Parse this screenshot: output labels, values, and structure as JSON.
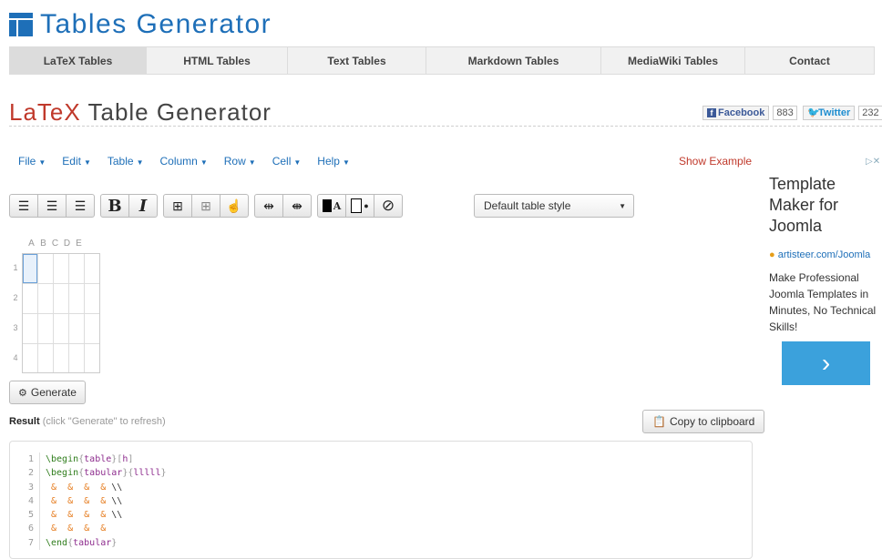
{
  "logo": {
    "text": "Tables Generator"
  },
  "nav": [
    {
      "label": "LaTeX Tables"
    },
    {
      "label": "HTML Tables"
    },
    {
      "label": "Text Tables"
    },
    {
      "label": "Markdown Tables"
    },
    {
      "label": "MediaWiki Tables"
    },
    {
      "label": "Contact"
    }
  ],
  "title": {
    "accent": "LaTeX",
    "rest": " Table Generator"
  },
  "social": {
    "facebook": {
      "label": "Facebook",
      "count": "883"
    },
    "twitter": {
      "label": "Twitter",
      "count": "232"
    }
  },
  "menu": [
    {
      "label": "File"
    },
    {
      "label": "Edit"
    },
    {
      "label": "Table"
    },
    {
      "label": "Column"
    },
    {
      "label": "Row"
    },
    {
      "label": "Cell"
    },
    {
      "label": "Help"
    }
  ],
  "show_example": "Show Example",
  "toolbar": {
    "bold": "B",
    "italic": "I",
    "text_color_glyph": "A",
    "style_select": "Default table style"
  },
  "grid": {
    "columns": [
      "A",
      "B",
      "C",
      "D",
      "E"
    ],
    "rows": [
      "1",
      "2",
      "3",
      "4"
    ]
  },
  "generate_label": "Generate",
  "result": {
    "label": "Result",
    "hint": "(click \"Generate\" to refresh)"
  },
  "copy_label": "Copy to clipboard",
  "code": {
    "line_numbers": [
      "1",
      "2",
      "3",
      "4",
      "5",
      "6",
      "7"
    ],
    "l1": {
      "cmd": "\\begin",
      "arg1": "table",
      "arg2": "h"
    },
    "l2": {
      "cmd": "\\begin",
      "arg1": "tabular",
      "arg2": "lllll"
    },
    "amp_row": " &  &  &  & ",
    "newline": "\\\\",
    "l7": {
      "cmd": "\\end",
      "arg1": "tabular"
    }
  },
  "ad": {
    "close": "▷✕",
    "title": "Template Maker for Joomla",
    "url": "artisteer.com/Joomla",
    "desc": "Make Professional Joomla Templates in Minutes, No Technical Skills!",
    "arrow": "›"
  }
}
